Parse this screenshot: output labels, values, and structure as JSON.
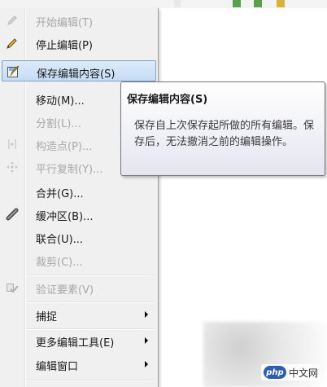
{
  "menu": {
    "items": [
      {
        "label": "开始编辑(T)",
        "icon": "pencil-icon",
        "state": "disabled"
      },
      {
        "label": "停止编辑(P)",
        "icon": "stop-edit-pencil-icon",
        "state": "enabled"
      },
      {
        "label": "保存编辑内容(S)",
        "icon": "save-edits-icon",
        "state": "highlighted"
      },
      {
        "label": "移动(M)...",
        "icon": "",
        "state": "enabled"
      },
      {
        "label": "分割(L)...",
        "icon": "",
        "state": "disabled"
      },
      {
        "label": "构造点(P)...",
        "icon": "construct-points-icon",
        "state": "disabled"
      },
      {
        "label": "平行复制(Y)...",
        "icon": "copy-parallel-icon",
        "state": "disabled"
      },
      {
        "label": "合并(G)...",
        "icon": "",
        "state": "enabled"
      },
      {
        "label": "缓冲区(B)...",
        "icon": "buffer-icon",
        "state": "enabled"
      },
      {
        "label": "联合(U)...",
        "icon": "",
        "state": "enabled"
      },
      {
        "label": "裁剪(C)...",
        "icon": "",
        "state": "disabled"
      },
      {
        "label": "验证要素(V)",
        "icon": "validate-features-icon",
        "state": "disabled"
      },
      {
        "label": "捕捉",
        "icon": "",
        "state": "enabled",
        "submenu": true
      },
      {
        "label": "更多编辑工具(E)",
        "icon": "",
        "state": "enabled",
        "submenu": true
      },
      {
        "label": "编辑窗口",
        "icon": "",
        "state": "enabled",
        "submenu": true
      }
    ]
  },
  "tooltip": {
    "title": "保存编辑内容(S)",
    "body": "保存自上次保存起所做的所有编辑。保存后，无法撤消之前的编辑操作。"
  },
  "watermark": {
    "logo": "php",
    "text": "中文网"
  },
  "colors": {
    "menu_bg": "#f0f0f0",
    "highlight": "#c6dcf5",
    "highlight_border": "#7da2ce",
    "disabled_text": "#a8a8a8"
  }
}
